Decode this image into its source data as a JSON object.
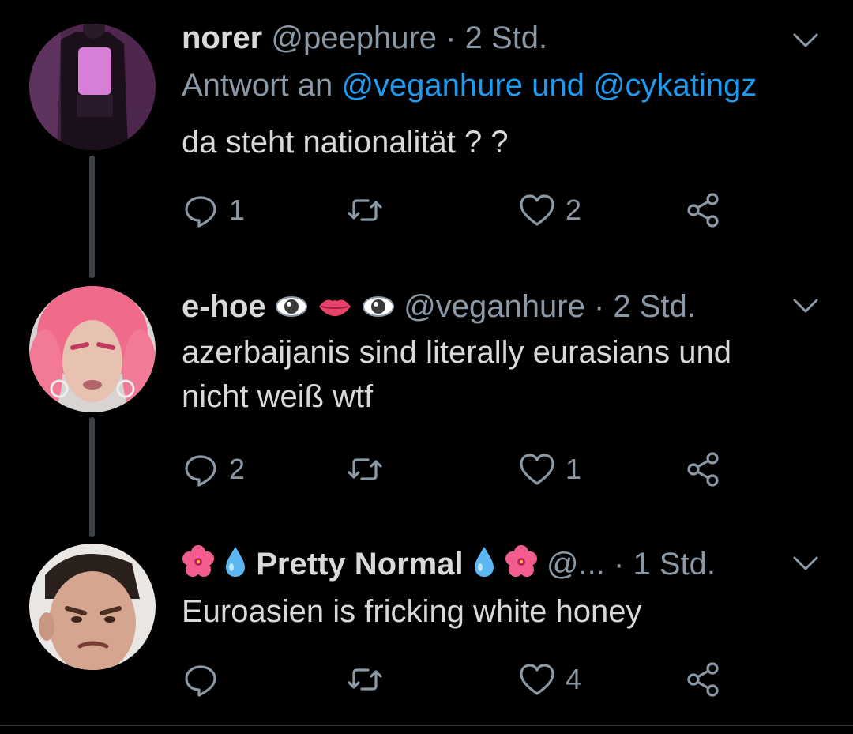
{
  "tweets": [
    {
      "name": "norer",
      "handle": "@peephure",
      "sep": " · ",
      "time": "2 Std.",
      "reply_prefix": "Antwort an ",
      "reply_to": "@veganhure und @cykatingz",
      "text": "da steht nationalität ? ?",
      "replies": "1",
      "retweets": "",
      "likes": "2"
    },
    {
      "name": "e-hoe",
      "handle": "@veganhure",
      "sep": " · ",
      "time": "2 Std.",
      "text_line1": "azerbaijanis sind literally eurasians und",
      "text_line2": "nicht weiß wtf",
      "replies": "2",
      "retweets": "",
      "likes": "1"
    },
    {
      "name": "Pretty Normal",
      "handle": "@...",
      "sep": " · ",
      "time": "1 Std.",
      "text": "Euroasien is fricking white honey",
      "replies": "",
      "retweets": "",
      "likes": "4"
    }
  ],
  "icons": {
    "reply": "speech-bubble-icon",
    "retweet": "retweet-icon",
    "like": "heart-icon",
    "share": "share-icon",
    "menu": "chevron-down-icon"
  },
  "colors": {
    "background": "#000000",
    "text": "#d9d9d9",
    "muted": "#8b98a5",
    "link": "#1d9bf0"
  }
}
